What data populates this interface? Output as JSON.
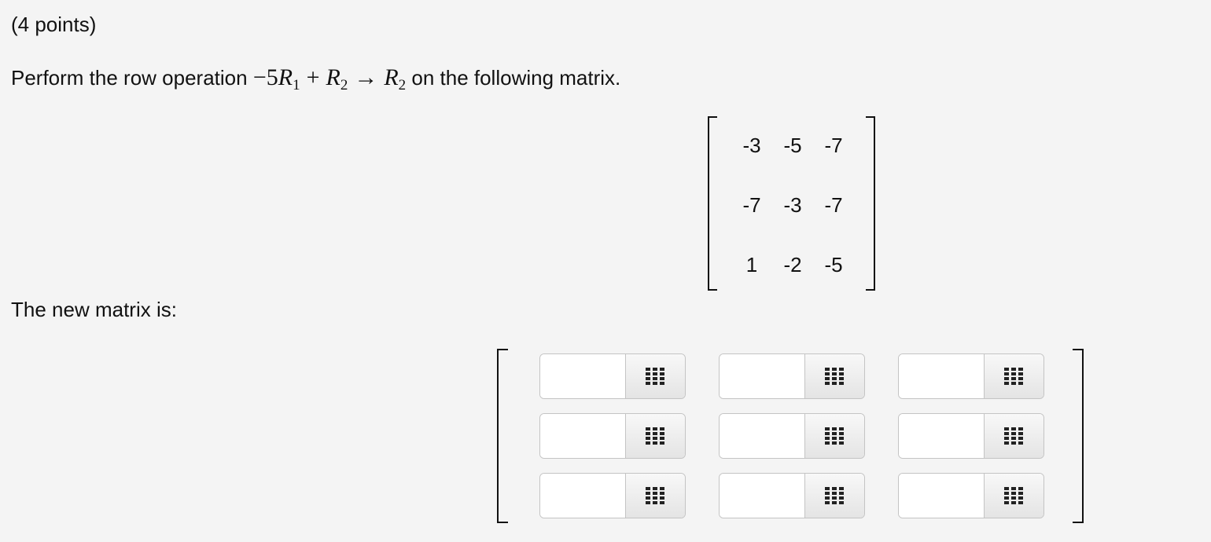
{
  "question": {
    "points": "(4 points)",
    "prompt_before": "Perform the row operation ",
    "prompt_after": " on the following matrix.",
    "operation": {
      "coefficient": "−5",
      "r1_letter": "R",
      "r1_sub": "1",
      "plus": "+",
      "r2_letter": "R",
      "r2_sub": "2",
      "arrow": "→",
      "target_letter": "R",
      "target_sub": "2"
    }
  },
  "matrix": {
    "rows": [
      [
        "-3",
        "-5",
        "-7"
      ],
      [
        "-7",
        "-3",
        "-7"
      ],
      [
        "1",
        "-2",
        "-5"
      ]
    ]
  },
  "answer": {
    "label": "The new matrix is:",
    "inputs": [
      [
        "",
        "",
        ""
      ],
      [
        "",
        "",
        ""
      ],
      [
        "",
        "",
        ""
      ]
    ],
    "addon_icon": "keypad-grid-icon"
  }
}
